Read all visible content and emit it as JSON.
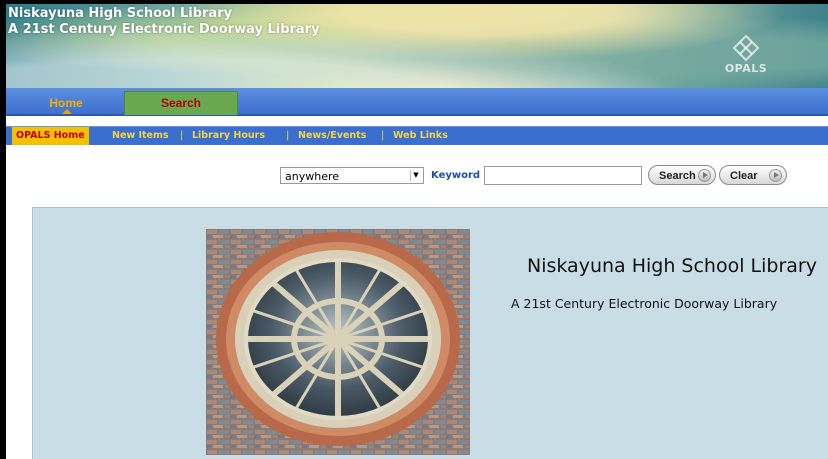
{
  "header": {
    "line1": "Niskayuna High School Library",
    "line2": "A 21st Century Electronic Doorway Library",
    "logo_text": "OPALS"
  },
  "tabs": [
    {
      "label": "Home",
      "active": true
    },
    {
      "label": "Search",
      "active": false
    }
  ],
  "subnav": {
    "items": [
      "OPALS Home",
      "New Items",
      "Library Hours",
      "News/Events",
      "Web Links"
    ],
    "separator": "|"
  },
  "search": {
    "scope_selected": "anywhere",
    "keyword_label": "Keyword",
    "keyword_value": "",
    "search_button": "Search",
    "clear_button": "Clear"
  },
  "main": {
    "title": "Niskayuna High School Library",
    "subtitle": "A 21st Century Electronic Doorway Library"
  },
  "colors": {
    "tab_bar": "#3f6fce",
    "subnav_bg": "#3a6fd0",
    "subnav_text": "#f4d44a",
    "active_tab_text": "#f2b000",
    "search_tab_bg": "#6aa84f",
    "panel_bg": "#c8dde6"
  }
}
